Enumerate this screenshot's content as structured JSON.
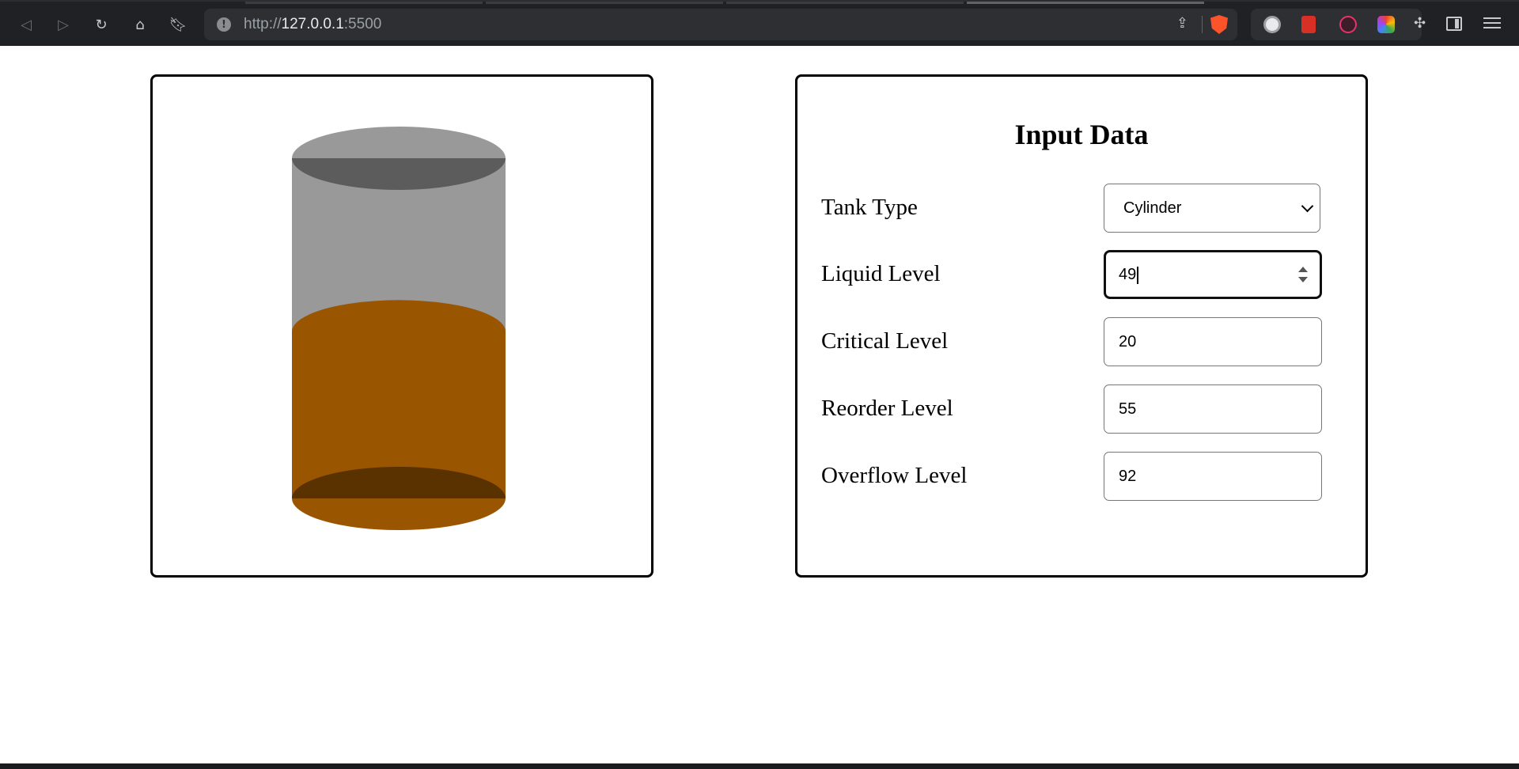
{
  "browser": {
    "url_prefix": "http://",
    "url_host": "127.0.0.1",
    "url_port": ":5500",
    "icons": [
      "back-icon",
      "forward-icon",
      "reload-icon",
      "home-icon",
      "bookmark-icon",
      "site-info-icon",
      "share-icon",
      "brave-shields-icon",
      "extensions-icon",
      "sidebar-icon",
      "menu-icon"
    ]
  },
  "tank": {
    "type": "Cylinder",
    "liquid_level_fraction": 0.49,
    "colors": {
      "shell": "#999999",
      "shell_inner": "#5c5c5c",
      "liquid": "#9a5500",
      "liquid_bottom": "#5a3200"
    }
  },
  "form": {
    "title": "Input Data",
    "tank_type": {
      "label": "Tank Type",
      "value": "Cylinder"
    },
    "liquid_level": {
      "label": "Liquid Level",
      "value": "49"
    },
    "critical_level": {
      "label": "Critical Level",
      "value": "20"
    },
    "reorder_level": {
      "label": "Reorder Level",
      "value": "55"
    },
    "overflow_level": {
      "label": "Overflow Level",
      "value": "92"
    }
  }
}
